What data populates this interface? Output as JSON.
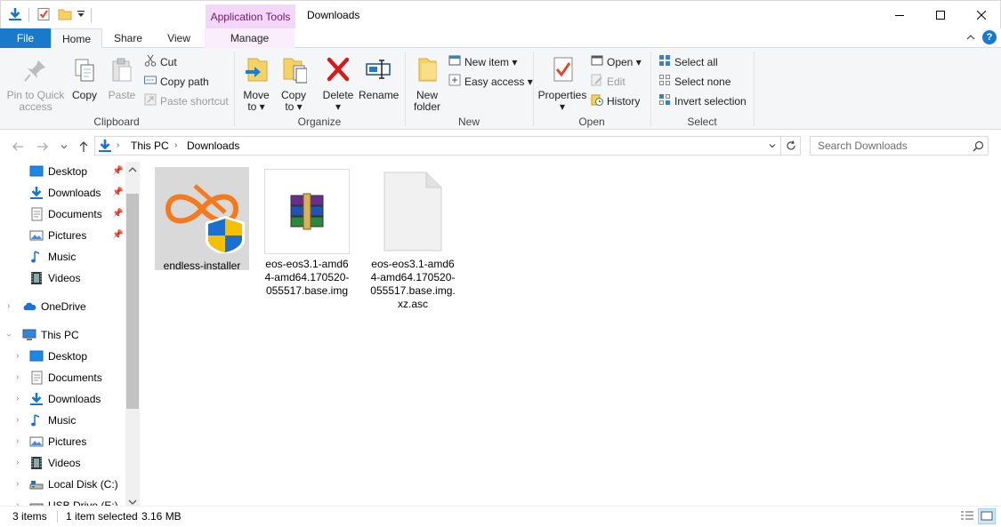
{
  "title_bar": {
    "context_tab": "Application Tools",
    "window_title": "Downloads"
  },
  "tabs": {
    "file": "File",
    "home": "Home",
    "share": "Share",
    "view": "View",
    "manage": "Manage"
  },
  "ribbon": {
    "clipboard": {
      "label": "Clipboard",
      "pin": "Pin to Quick access",
      "pin_line1": "Pin to Quick",
      "pin_line2": "access",
      "copy": "Copy",
      "paste": "Paste",
      "cut": "Cut",
      "copy_path": "Copy path",
      "paste_shortcut": "Paste shortcut"
    },
    "organize": {
      "label": "Organize",
      "move_to": "Move",
      "move_to_2": "to",
      "copy_to": "Copy",
      "copy_to_2": "to",
      "delete": "Delete",
      "rename": "Rename"
    },
    "new": {
      "label": "New",
      "new_folder": "New",
      "new_folder_2": "folder",
      "new_item": "New item",
      "easy_access": "Easy access"
    },
    "open": {
      "label": "Open",
      "properties": "Properties",
      "open": "Open",
      "edit": "Edit",
      "history": "History"
    },
    "select": {
      "label": "Select",
      "select_all": "Select all",
      "select_none": "Select none",
      "invert_selection": "Invert selection"
    }
  },
  "address": {
    "crumbs": [
      "This PC",
      "Downloads"
    ],
    "search_placeholder": "Search Downloads"
  },
  "nav_pane": {
    "quick_access": [
      {
        "label": "Desktop",
        "icon": "desktop-icon"
      },
      {
        "label": "Downloads",
        "icon": "downloads-icon"
      },
      {
        "label": "Documents",
        "icon": "documents-icon"
      },
      {
        "label": "Pictures",
        "icon": "pictures-icon"
      },
      {
        "label": "Music",
        "icon": "music-icon"
      },
      {
        "label": "Videos",
        "icon": "videos-icon"
      }
    ],
    "onedrive": "OneDrive",
    "this_pc": "This PC",
    "this_pc_items": [
      {
        "label": "Desktop"
      },
      {
        "label": "Documents"
      },
      {
        "label": "Downloads"
      },
      {
        "label": "Music"
      },
      {
        "label": "Pictures"
      },
      {
        "label": "Videos"
      },
      {
        "label": "Local Disk (C:)"
      },
      {
        "label": "USB Drive (E:)"
      }
    ]
  },
  "files": [
    {
      "name": "endless-installer",
      "selected": true
    },
    {
      "name": "eos-eos3.1-amd64-amd64.170520-055517.base.img",
      "display": [
        "eos-eos3.1-amd6",
        "4-amd64.170520-",
        "055517.base.img"
      ],
      "selected": false
    },
    {
      "name": "eos-eos3.1-amd64-amd64.170520-055517.base.img.xz.asc",
      "display": [
        "eos-eos3.1-amd6",
        "4-amd64.170520-",
        "055517.base.img.",
        "xz.asc"
      ],
      "selected": false
    }
  ],
  "status": {
    "item_count": "3 items",
    "selection": "1 item selected",
    "size": "3.16 MB"
  },
  "colors": {
    "file_tab": "#1979ca",
    "context_tab_bg": "#f4d7f8",
    "selection_bg": "#cce8ff",
    "selected_tile": "#d9d9d9"
  }
}
